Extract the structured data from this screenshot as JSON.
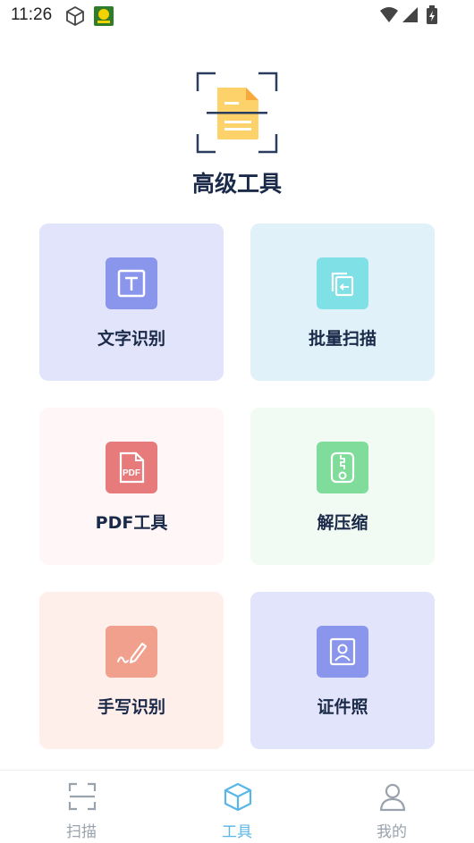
{
  "status_bar": {
    "time": "11:26",
    "icons": [
      "cube-outline-icon",
      "app-badge-icon",
      "wifi-icon",
      "signal-icon",
      "battery-charging-icon"
    ]
  },
  "header": {
    "icon": "document-scan-icon",
    "title": "高级工具"
  },
  "tools": [
    {
      "label": "文字识别",
      "icon": "text-recognition-icon",
      "card_bg": "#e1e4fa",
      "icon_bg": "#8a95ec"
    },
    {
      "label": "批量扫描",
      "icon": "batch-scan-icon",
      "card_bg": "#e0f1fa",
      "icon_bg": "#7fe0e6"
    },
    {
      "label": "PDF工具",
      "icon": "pdf-icon",
      "icon_text": "PDF",
      "card_bg": "#fff7f7",
      "icon_bg": "#e77b7b"
    },
    {
      "label": "解压缩",
      "icon": "zip-icon",
      "card_bg": "#f1fbf4",
      "icon_bg": "#7fdc9a"
    },
    {
      "label": "手写识别",
      "icon": "handwriting-icon",
      "card_bg": "#ffefea",
      "icon_bg": "#f0a08c"
    },
    {
      "label": "证件照",
      "icon": "id-photo-icon",
      "card_bg": "#e1e4fa",
      "icon_bg": "#8a95ec"
    }
  ],
  "bottom_nav": [
    {
      "label": "扫描",
      "icon": "scan-icon",
      "active": false
    },
    {
      "label": "工具",
      "icon": "box-icon",
      "active": true
    },
    {
      "label": "我的",
      "icon": "user-icon",
      "active": false
    }
  ],
  "colors": {
    "accent": "#5ab6e6",
    "inactive": "#9aa3ad",
    "title": "#1c2a4a"
  }
}
